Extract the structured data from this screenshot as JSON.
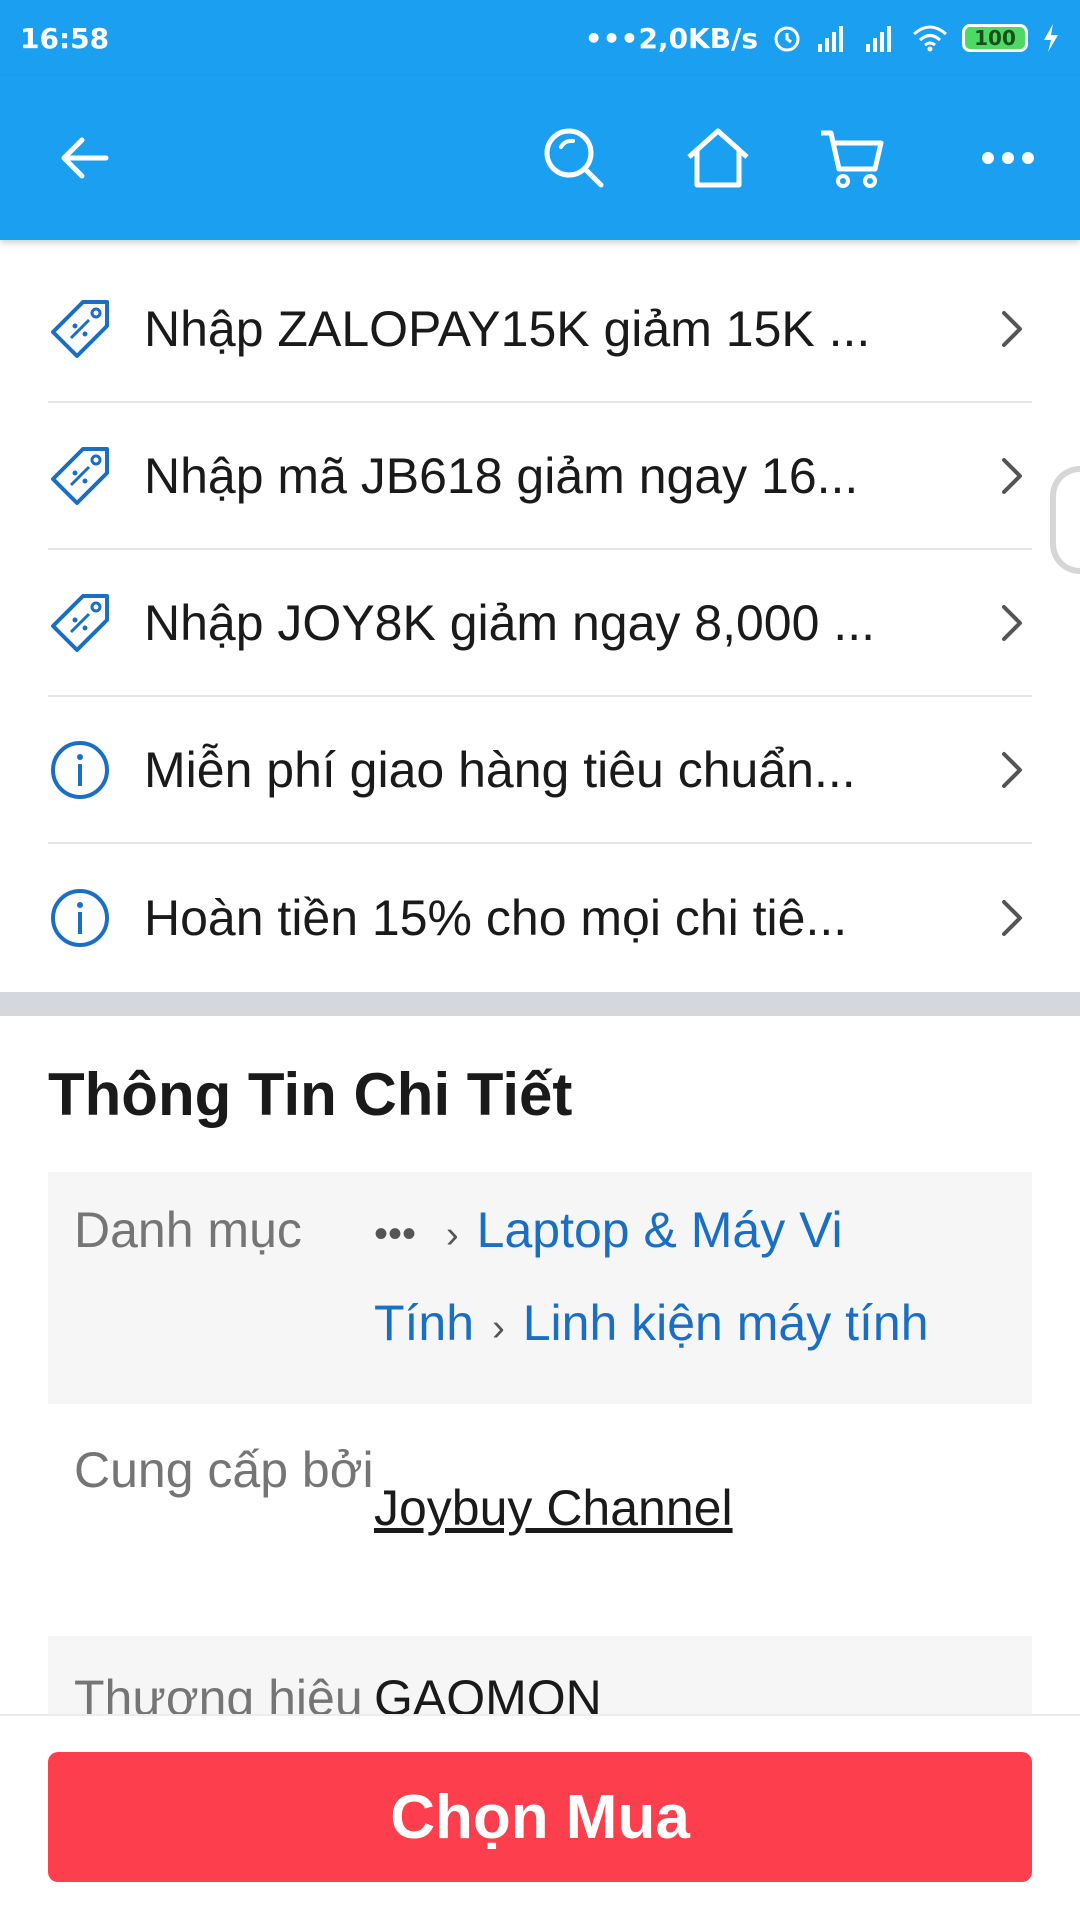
{
  "status_bar": {
    "time": "16:58",
    "network_speed": "2,0KB/s",
    "battery": "100"
  },
  "header": {
    "icons": [
      "back-arrow-icon",
      "search-icon",
      "home-icon",
      "cart-icon",
      "more-icon"
    ]
  },
  "promotions": [
    {
      "icon": "coupon-icon",
      "label": "Nhập ZALOPAY15K giảm 15K ..."
    },
    {
      "icon": "coupon-icon",
      "label": "Nhập mã JB618 giảm ngay 16..."
    },
    {
      "icon": "coupon-icon",
      "label": "Nhập JOY8K giảm ngay 8,000 ..."
    },
    {
      "icon": "info-icon",
      "label": "Miễn phí giao hàng tiêu chuẩn..."
    },
    {
      "icon": "info-icon",
      "label": "Hoàn tiền 15% cho mọi chi tiê..."
    }
  ],
  "details": {
    "title": "Thông Tin Chi Tiết",
    "category_label": "Danh mục",
    "category_ellipsis": "•••",
    "category_path": [
      "Laptop & Máy Vi Tính",
      "Linh kiện máy tính"
    ],
    "seller_label": "Cung cấp bởi",
    "seller_value": "Joybuy Channel",
    "brand_label": "Thương hiệu",
    "brand_value": "GAOMON"
  },
  "buy_button": {
    "label": "Chọn Mua"
  },
  "colors": {
    "primary": "#1ba0f1",
    "buy": "#fd3f4d",
    "link": "#1a6fc4"
  }
}
